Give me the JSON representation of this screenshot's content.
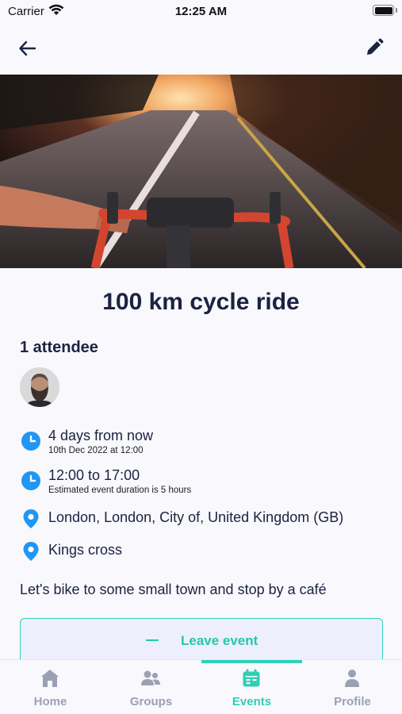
{
  "status_bar": {
    "carrier": "Carrier",
    "time": "12:25 AM"
  },
  "nav": {
    "back_icon": "arrow-left-icon",
    "edit_icon": "pencil-icon"
  },
  "event": {
    "title": "100 km cycle ride",
    "attendees_label": "1 attendee",
    "when": {
      "relative": "4 days from now",
      "absolute": "10th Dec 2022 at 12:00"
    },
    "duration": {
      "range": "12:00 to 17:00",
      "note": "Estimated event duration is 5 hours"
    },
    "location": "London, London, City of, United Kingdom (GB)",
    "meeting_point": "Kings cross",
    "description": "Let's bike to some small town and stop by a café",
    "leave_button_label": "Leave event"
  },
  "tabs": [
    {
      "label": "Home",
      "icon": "home-icon",
      "active": false
    },
    {
      "label": "Groups",
      "icon": "people-icon",
      "active": false
    },
    {
      "label": "Events",
      "icon": "calendar-icon",
      "active": true
    },
    {
      "label": "Profile",
      "icon": "person-icon",
      "active": false
    }
  ],
  "colors": {
    "accent": "#2fd2b6",
    "icon_blue": "#2196f3",
    "text_dark": "#1c2240",
    "tab_inactive": "#9ba0b3"
  }
}
